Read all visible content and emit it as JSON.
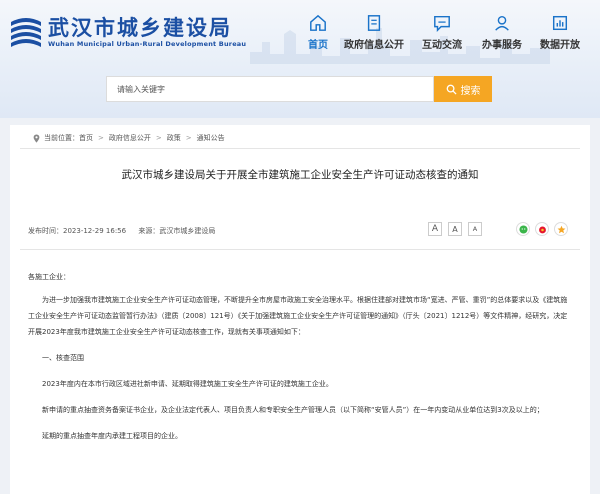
{
  "header": {
    "title": "武汉市城乡建设局",
    "subtitle": "Wuhan Municipal Urban-Rural Development Bureau",
    "nav": [
      {
        "label": "首页",
        "icon": "home-icon",
        "active": true
      },
      {
        "label": "政府信息公开",
        "icon": "document-icon",
        "active": false
      },
      {
        "label": "互动交流",
        "icon": "chat-icon",
        "active": false
      },
      {
        "label": "办事服务",
        "icon": "service-icon",
        "active": false
      },
      {
        "label": "数据开放",
        "icon": "chart-icon",
        "active": false
      }
    ],
    "search": {
      "placeholder": "请输入关键字",
      "button_label": "搜索"
    }
  },
  "breadcrumb": {
    "prefix": "当前位置：",
    "items": [
      "首页",
      "政府信息公开",
      "政策",
      "通知公告"
    ]
  },
  "article": {
    "title": "武汉市城乡建设局关于开展全市建筑施工企业安全生产许可证动态核查的通知",
    "publish_time": "发布时间：2023-12-29 16:56",
    "source": "来源：武汉市城乡建设局",
    "font_sizes": [
      "A",
      "A",
      "A"
    ],
    "paragraphs": [
      "各施工企业：",
      "为进一步加强我市建筑施工企业安全生产许可证动态管理，不断提升全市房屋市政施工安全治理水平。根据住建部对建筑市场“宽进、严管、重罚”的总体要求以及《建筑施工企业安全生产许可证动态监管暂行办法》（建质〔2008〕121号）《关于加强建筑施工企业安全生产许可证管理的通知》（厅头〔2021〕1212号）等文件精神，经研究，决定开展2023年度我市建筑施工企业安全生产许可证动态核查工作，现就有关事项通知如下：",
      "一、核查范围",
      "2023年度内在本市行政区域进社新申请、延期取得建筑施工安全生产许可证的建筑施工企业。",
      "新申请的重点抽查资务备案证书企业，及企业法定代表人、项目负责人和专职安全生产管理人员（以下简称“安管人员”）在一年内变动从业单位达到3次及以上的；",
      "延期的重点抽查年度内承建工程项目的企业。"
    ]
  },
  "colors": {
    "brand": "#1b4fa3",
    "accent": "#f5a623",
    "active_nav": "#1a73c9"
  }
}
